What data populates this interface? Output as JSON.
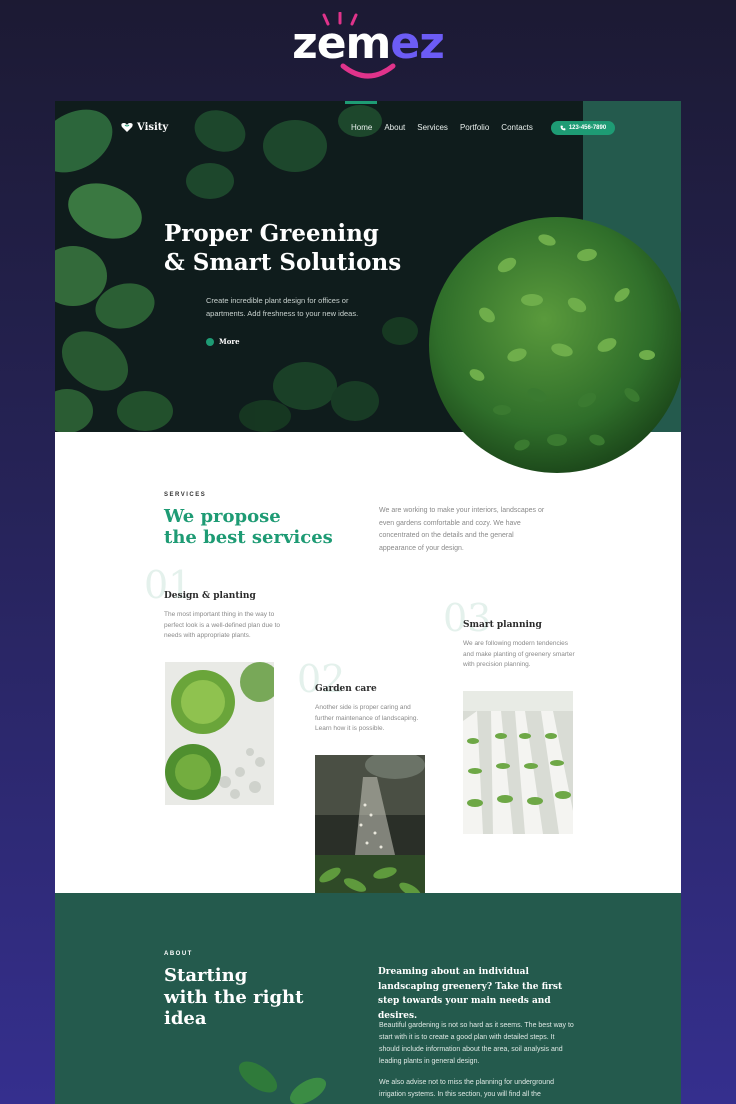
{
  "brand": {
    "name_part1": "zem",
    "name_part2": "ez"
  },
  "header": {
    "logo_text": "Visity",
    "nav": [
      "Home",
      "About",
      "Services",
      "Portfolio",
      "Contacts"
    ],
    "phone": "123-456-7890"
  },
  "hero": {
    "title_line1": "Proper Greening",
    "title_line2": "& Smart Solutions",
    "description": "Create incredible plant design for offices or apartments. Add freshness to your new ideas.",
    "more_label": "More"
  },
  "services": {
    "eyebrow": "SERVICES",
    "title_line1": "We propose",
    "title_line2": "the best services",
    "intro": "We are working to make your interiors, landscapes or even gardens comfortable and cozy. We have concentrated on the details and the general appearance of your design.",
    "items": [
      {
        "number": "01",
        "title": "Design & planting",
        "text": "The most important thing in the way to perfect look is a well-defined plan due to needs with appropriate plants."
      },
      {
        "number": "02",
        "title": "Garden care",
        "text": "Another side is proper caring and further maintenance of landscaping. Learn how it is possible."
      },
      {
        "number": "03",
        "title": "Smart planning",
        "text": "We are following modern tendencies and make planting of greenery smarter with precision planning."
      }
    ]
  },
  "about": {
    "eyebrow": "ABOUT",
    "title_line1": "Starting",
    "title_line2": "with the right",
    "title_line3": "idea",
    "lead": "Dreaming about an individual landscaping greenery? Take the first step towards your main needs and desires.",
    "p1": "Beautiful gardening is not so hard as it seems. The best way to start with it is to create a good plan with detailed steps. It should include information about the area, soil analysis and leading plants in general design.",
    "p2": "We also advise not to miss the planning for underground irrigation systems. In this section, you will find all the"
  },
  "colors": {
    "accent": "#1e9b74",
    "dark_green": "#245a4d",
    "brand_purple": "#6c5cf5",
    "smile_pink": "#e0338b"
  },
  "icons": {
    "logo": "leaf-heart-icon",
    "phone": "phone-icon",
    "more": "dot-icon"
  }
}
